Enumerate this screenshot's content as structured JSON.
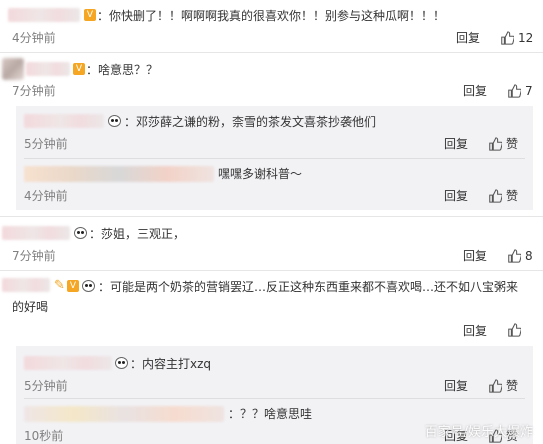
{
  "comments": [
    {
      "text": "：你快删了！！啊啊啊我真的很喜欢你！！别参与这种瓜啊！！！",
      "time": "4分钟前",
      "reply": "回复",
      "likes": "12"
    },
    {
      "text": "：啥意思？？",
      "time": "7分钟前",
      "reply": "回复",
      "likes": "7",
      "subs": [
        {
          "text": "：邓莎薛之谦的粉，柰雪的茶发文喜茶抄袭他们",
          "time": "5分钟前",
          "reply": "回复",
          "like": "赞"
        },
        {
          "text": "嘿嘿多谢科普～",
          "time": "4分钟前",
          "reply": "回复",
          "like": "赞"
        }
      ]
    },
    {
      "text": "：莎姐，三观正，",
      "time": "7分钟前",
      "reply": "回复",
      "likes": "8"
    },
    {
      "text_line1": "：可能是两个奶茶的营销罢辽…反正这种东西重来都不喜欢喝…还不如八宝粥来",
      "text_line2": "的好喝",
      "time": "",
      "reply": "回复",
      "likes": "",
      "subs": [
        {
          "text": "：内容主打xzq",
          "time": "5分钟前",
          "reply": "回复",
          "like": "赞"
        },
        {
          "text": "：？？啥意思哇",
          "time": "10秒前",
          "reply": "回复",
          "like": "赞"
        }
      ]
    }
  ],
  "watermark": "百家号/娱乐大爆炸",
  "colors": {
    "background": "#ffffff",
    "subbox": "#f2f2f5",
    "time": "#808080"
  }
}
